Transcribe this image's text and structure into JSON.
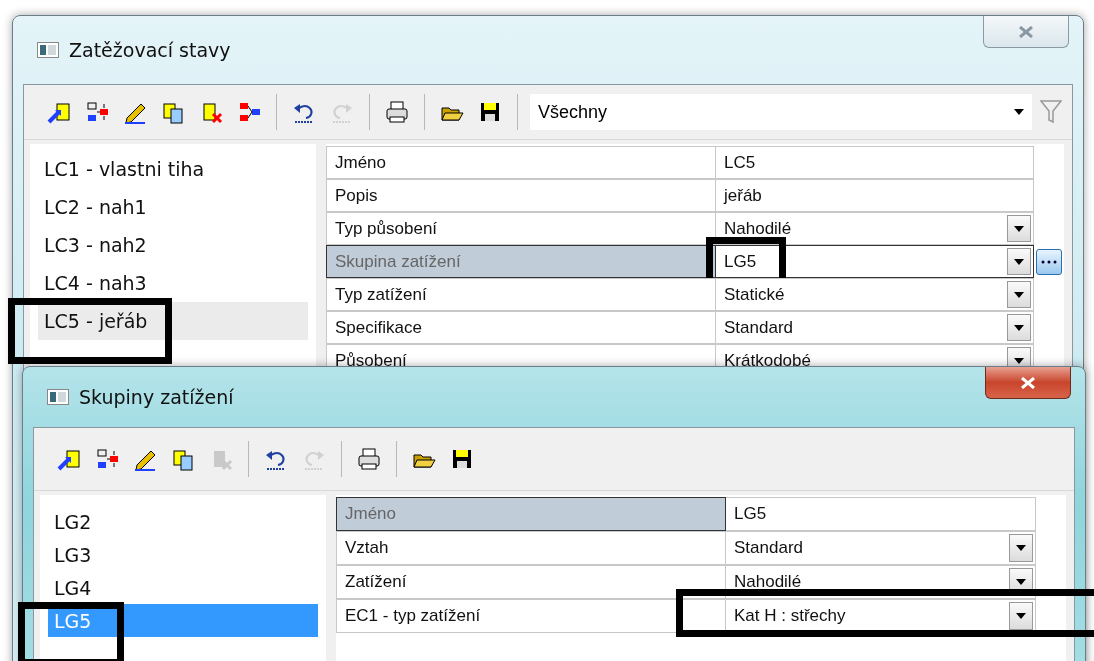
{
  "windows": [
    {
      "title": "Zatěžovací stavy",
      "active": false,
      "toolbar": [
        [
          {
            "kind": "new",
            "disabled": false
          },
          {
            "kind": "move",
            "disabled": false
          },
          {
            "kind": "edit",
            "disabled": false
          },
          {
            "kind": "copy",
            "disabled": false
          },
          {
            "kind": "delete",
            "disabled": false
          },
          {
            "kind": "split",
            "disabled": false
          }
        ],
        [
          {
            "kind": "undo",
            "disabled": false
          },
          {
            "kind": "redo",
            "disabled": true
          }
        ],
        [
          {
            "kind": "print",
            "disabled": false
          }
        ],
        [
          {
            "kind": "open",
            "disabled": false
          },
          {
            "kind": "save",
            "disabled": false
          }
        ]
      ],
      "filter": "Všechny",
      "list": [
        {
          "label": "LC1 - vlastni tiha",
          "selected": false,
          "marked": false
        },
        {
          "label": "LC2 - nah1",
          "selected": false,
          "marked": false
        },
        {
          "label": "LC3 - nah2",
          "selected": false,
          "marked": false
        },
        {
          "label": "LC4 - nah3",
          "selected": false,
          "marked": false
        },
        {
          "label": "LC5 - jeřáb",
          "selected": true,
          "marked": true
        }
      ],
      "properties": [
        {
          "name": "Jméno",
          "value": "LC5",
          "kind": "text",
          "selected": false,
          "marked": false
        },
        {
          "name": "Popis",
          "value": "jeřáb",
          "kind": "text",
          "selected": false,
          "marked": false
        },
        {
          "name": "Typ působení",
          "value": "Nahodilé",
          "kind": "dropdown",
          "selected": false,
          "marked": false
        },
        {
          "name": "Skupina zatížení",
          "value": "LG5",
          "kind": "dropdown-more",
          "selected": true,
          "marked": true
        },
        {
          "name": "Typ zatížení",
          "value": "Statické",
          "kind": "dropdown",
          "selected": false,
          "marked": false
        },
        {
          "name": "Specifikace",
          "value": "Standard",
          "kind": "dropdown",
          "selected": false,
          "marked": false
        },
        {
          "name": "Působení",
          "value": "Krátkodobé",
          "kind": "dropdown",
          "selected": false,
          "marked": false
        }
      ]
    },
    {
      "title": "Skupiny zatížení",
      "active": true,
      "toolbar": [
        [
          {
            "kind": "new",
            "disabled": false
          },
          {
            "kind": "move",
            "disabled": false
          },
          {
            "kind": "edit",
            "disabled": false
          },
          {
            "kind": "copy",
            "disabled": false
          },
          {
            "kind": "delete",
            "disabled": true
          }
        ],
        [
          {
            "kind": "undo",
            "disabled": false
          },
          {
            "kind": "redo",
            "disabled": true
          }
        ],
        [
          {
            "kind": "print",
            "disabled": false
          }
        ],
        [
          {
            "kind": "open",
            "disabled": false
          },
          {
            "kind": "save",
            "disabled": false
          }
        ]
      ],
      "list": [
        {
          "label": "LG2",
          "selected": false,
          "marked": false
        },
        {
          "label": "LG3",
          "selected": false,
          "marked": false
        },
        {
          "label": "LG4",
          "selected": false,
          "marked": false
        },
        {
          "label": "LG5",
          "selected": true,
          "marked": true
        }
      ],
      "properties": [
        {
          "name": "Jméno",
          "value": "LG5",
          "kind": "text",
          "selected": true,
          "marked": false
        },
        {
          "name": "Vztah",
          "value": "Standard",
          "kind": "dropdown",
          "selected": false,
          "marked": false
        },
        {
          "name": "Zatížení",
          "value": "Nahodilé",
          "kind": "dropdown",
          "selected": false,
          "marked": false
        },
        {
          "name": "EC1 - typ zatížení",
          "value": "Kat H : střechy",
          "kind": "dropdown",
          "selected": false,
          "marked": true
        }
      ]
    }
  ]
}
